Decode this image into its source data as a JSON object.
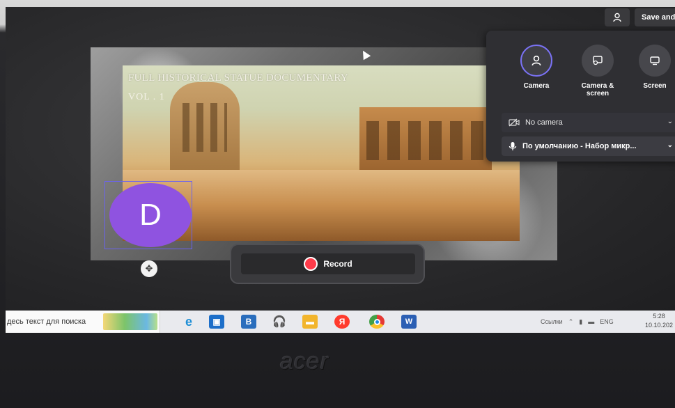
{
  "header": {
    "profile_icon": "person-icon",
    "save_label": "Save and"
  },
  "video": {
    "title": "FULL HISTORICAL STATUE DOCUMENTARY",
    "subtitle": "VOL . 1"
  },
  "avatar": {
    "initial": "D",
    "color": "#8f53e0"
  },
  "record": {
    "label": "Record",
    "dot_color": "#ff3b4a"
  },
  "source_panel": {
    "options": [
      {
        "label": "Camera",
        "sub": "",
        "icon": "person-icon",
        "selected": true
      },
      {
        "label": "Camera &",
        "sub": "screen",
        "icon": "camera-screen-icon",
        "selected": false
      },
      {
        "label": "Screen",
        "sub": "",
        "icon": "monitor-icon",
        "selected": false
      }
    ],
    "camera_select": "No camera",
    "mic_select": "По умолчанию - Набор микр..."
  },
  "taskbar": {
    "search_text": "десь текст для поиска",
    "tray_label": "Ссылки",
    "lang": "ENG",
    "time": "5:28",
    "date": "10.10.202"
  },
  "laptop": {
    "brand": "acer"
  },
  "colors": {
    "accent": "#7a72f5",
    "record": "#ff3b4a",
    "avatar": "#8f53e0"
  }
}
